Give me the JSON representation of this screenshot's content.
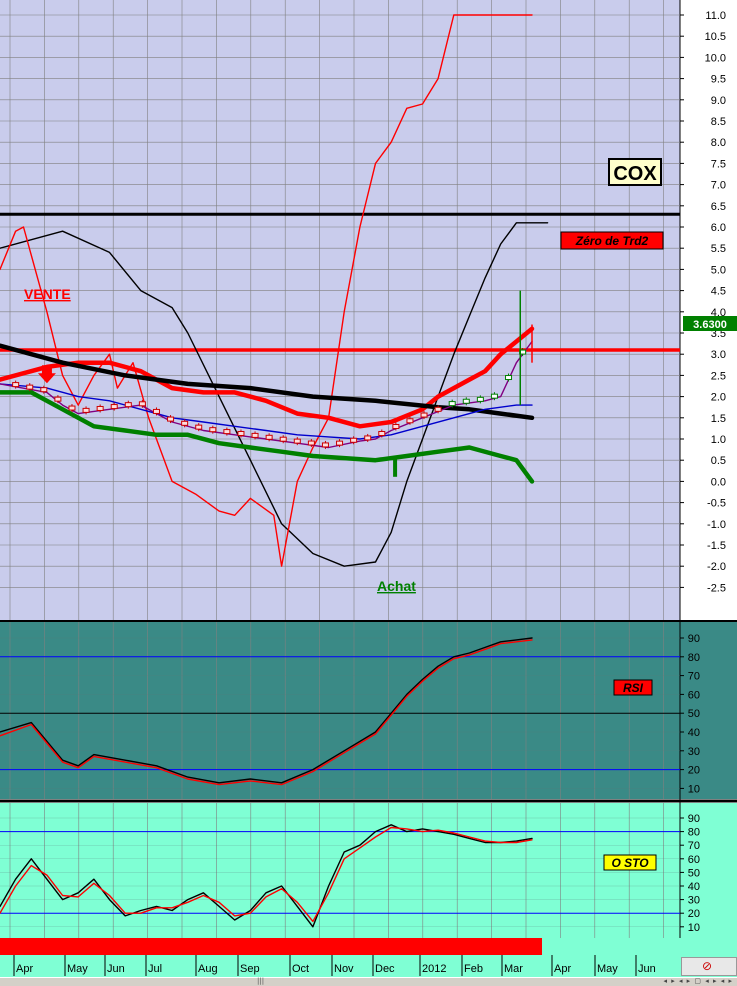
{
  "chart_data": [
    {
      "type": "line",
      "panel": "price",
      "ticker": "COX",
      "last_price_label": "3.6300",
      "ylim": [
        -3.0,
        11.3
      ],
      "y_ticks": [
        "11.0",
        "10.5",
        "10.0",
        "9.5",
        "9.0",
        "8.5",
        "8.0",
        "7.5",
        "7.0",
        "6.5",
        "6.0",
        "5.5",
        "5.0",
        "4.5",
        "4.0",
        "3.5",
        "3.0",
        "2.5",
        "2.0",
        "1.5",
        "1.0",
        "0.5",
        "0.0",
        "-0.5",
        "-1.0",
        "-1.5",
        "-2.0",
        "-2.5"
      ],
      "labels": {
        "sell": "VENTE",
        "buy": "Achat",
        "zero_line": "Zéro de Trd2"
      },
      "horizontal_lines": [
        {
          "y": 6.3,
          "color": "#000000"
        },
        {
          "y": 3.1,
          "color": "#ff0000"
        }
      ],
      "series": [
        {
          "color": "#000000",
          "x": [
            0,
            8,
            14,
            18,
            22,
            24,
            28,
            32,
            36,
            40,
            44,
            48,
            50,
            52,
            54,
            56,
            58,
            60,
            62,
            64,
            66,
            68,
            70
          ],
          "y": [
            5.5,
            5.9,
            5.4,
            4.5,
            4.1,
            3.5,
            2.0,
            0.5,
            -1.0,
            -1.7,
            -2.0,
            -1.9,
            -1.2,
            0.0,
            1.0,
            2.0,
            3.0,
            3.9,
            4.8,
            5.6,
            6.1,
            6.1,
            6.1
          ]
        },
        {
          "color": "#ff0000",
          "x": [
            0,
            2,
            3,
            6,
            8,
            10,
            12,
            14,
            15,
            17,
            19,
            22,
            25,
            28,
            30,
            32,
            35,
            36,
            38,
            40,
            42,
            44,
            46,
            48,
            50,
            52,
            54,
            56,
            58,
            60,
            62,
            64,
            66,
            68
          ],
          "y": [
            5.0,
            5.9,
            6.0,
            4.0,
            2.5,
            1.8,
            2.5,
            3.0,
            2.2,
            2.8,
            1.5,
            0.0,
            -0.3,
            -0.7,
            -0.8,
            -0.4,
            -0.8,
            -2.0,
            0.0,
            0.8,
            1.5,
            4.0,
            6.0,
            7.5,
            8.0,
            8.8,
            8.9,
            9.5,
            11.0,
            11.0,
            11.0,
            11.0,
            11.0,
            11.0
          ]
        },
        {
          "color": "#ff0000",
          "bold": true,
          "x": [
            0,
            6,
            10,
            14,
            18,
            22,
            26,
            30,
            34,
            38,
            42,
            46,
            50,
            54,
            56,
            58,
            60,
            62,
            64,
            66,
            68
          ],
          "y": [
            2.4,
            2.7,
            2.8,
            2.8,
            2.6,
            2.2,
            2.1,
            2.1,
            1.9,
            1.6,
            1.5,
            1.3,
            1.4,
            1.7,
            2.0,
            2.2,
            2.4,
            2.6,
            3.0,
            3.3,
            3.6
          ]
        },
        {
          "color": "#000000",
          "bold": true,
          "x": [
            0,
            8,
            16,
            24,
            32,
            40,
            48,
            56,
            60,
            64,
            68
          ],
          "y": [
            3.2,
            2.8,
            2.5,
            2.3,
            2.2,
            2.0,
            1.9,
            1.75,
            1.7,
            1.6,
            1.5
          ]
        },
        {
          "color": "#0000cc",
          "x": [
            0,
            6,
            10,
            14,
            18,
            22,
            26,
            30,
            34,
            38,
            42,
            46,
            50,
            54,
            58,
            62,
            66,
            68
          ],
          "y": [
            2.3,
            2.2,
            2.0,
            1.9,
            1.7,
            1.5,
            1.4,
            1.3,
            1.2,
            1.1,
            1.05,
            1.0,
            1.1,
            1.3,
            1.5,
            1.7,
            1.8,
            1.8
          ]
        },
        {
          "color": "#800080",
          "x": [
            0,
            6,
            8,
            10,
            14,
            18,
            22,
            26,
            30,
            34,
            38,
            42,
            46,
            48,
            50,
            54,
            58,
            62,
            64,
            66,
            68
          ],
          "y": [
            2.3,
            2.1,
            1.8,
            1.6,
            1.7,
            1.8,
            1.4,
            1.2,
            1.1,
            1.0,
            0.9,
            0.8,
            0.95,
            1.0,
            1.2,
            1.5,
            1.8,
            1.9,
            2.0,
            2.8,
            3.3
          ]
        },
        {
          "color": "#008000",
          "bold": true,
          "x": [
            0,
            4,
            8,
            12,
            16,
            20,
            24,
            28,
            32,
            36,
            40,
            44,
            48,
            52,
            56,
            60,
            64,
            66,
            68
          ],
          "y": [
            2.1,
            2.1,
            1.7,
            1.3,
            1.2,
            1.1,
            1.1,
            0.9,
            0.8,
            0.7,
            0.6,
            0.55,
            0.5,
            0.6,
            0.7,
            0.8,
            0.6,
            0.5,
            0.0
          ]
        }
      ]
    },
    {
      "type": "line",
      "panel": "rsi",
      "title": "RSI",
      "ylim": [
        0,
        98
      ],
      "y_ticks": [
        90,
        80,
        70,
        60,
        50,
        40,
        30,
        20,
        10
      ],
      "horizontal_lines": [
        {
          "y": 80,
          "color": "#0000ff"
        },
        {
          "y": 50,
          "color": "#000000"
        },
        {
          "y": 20,
          "color": "#0000ff"
        }
      ],
      "series": [
        {
          "color": "#000000",
          "x": [
            0,
            4,
            8,
            10,
            12,
            16,
            20,
            24,
            28,
            32,
            36,
            40,
            44,
            48,
            50,
            52,
            54,
            56,
            58,
            60,
            62,
            64,
            66,
            68
          ],
          "y": [
            40,
            45,
            25,
            22,
            28,
            25,
            22,
            16,
            13,
            15,
            13,
            20,
            30,
            40,
            50,
            60,
            68,
            75,
            80,
            82,
            85,
            88,
            89,
            90
          ]
        },
        {
          "color": "#ff0000",
          "x": [
            0,
            4,
            8,
            10,
            12,
            16,
            20,
            24,
            28,
            32,
            36,
            40,
            44,
            48,
            50,
            52,
            54,
            56,
            58,
            60,
            62,
            64,
            66,
            68
          ],
          "y": [
            38,
            44,
            24,
            21,
            27,
            24,
            21,
            15,
            12,
            14,
            12,
            19,
            29,
            39,
            49,
            59,
            67,
            74,
            79,
            81,
            84,
            87,
            88,
            89
          ]
        }
      ]
    },
    {
      "type": "line",
      "panel": "stochastic",
      "title": "O STO",
      "ylim": [
        0,
        98
      ],
      "y_ticks": [
        90,
        80,
        70,
        60,
        50,
        40,
        30,
        20,
        10
      ],
      "horizontal_lines": [
        {
          "y": 80,
          "color": "#0000ff"
        },
        {
          "y": 20,
          "color": "#0000ff"
        }
      ],
      "series": [
        {
          "color": "#000000",
          "x": [
            0,
            2,
            4,
            6,
            8,
            10,
            12,
            14,
            16,
            18,
            20,
            22,
            24,
            26,
            28,
            30,
            32,
            34,
            36,
            38,
            40,
            42,
            44,
            46,
            48,
            50,
            52,
            54,
            56,
            58,
            60,
            62,
            64,
            66,
            68
          ],
          "y": [
            25,
            45,
            60,
            45,
            30,
            35,
            45,
            30,
            18,
            22,
            25,
            22,
            30,
            35,
            25,
            15,
            22,
            35,
            40,
            25,
            10,
            40,
            65,
            70,
            80,
            85,
            80,
            82,
            80,
            78,
            75,
            72,
            72,
            73,
            75
          ]
        },
        {
          "color": "#ff0000",
          "x": [
            0,
            2,
            4,
            6,
            8,
            10,
            12,
            14,
            16,
            18,
            20,
            22,
            24,
            26,
            28,
            30,
            32,
            34,
            36,
            38,
            40,
            42,
            44,
            46,
            48,
            50,
            52,
            54,
            56,
            58,
            60,
            62,
            64,
            66,
            68
          ],
          "y": [
            20,
            40,
            55,
            48,
            33,
            32,
            42,
            33,
            20,
            20,
            24,
            24,
            28,
            33,
            28,
            18,
            20,
            32,
            38,
            28,
            14,
            35,
            60,
            68,
            76,
            83,
            82,
            80,
            81,
            79,
            76,
            73,
            72,
            72,
            74
          ]
        }
      ]
    },
    {
      "type": "table",
      "panel": "time_axis",
      "month_labels": [
        "Apr",
        "May",
        "Jun",
        "Jul",
        "Aug",
        "Sep",
        "Oct",
        "Nov",
        "Dec",
        "2012",
        "Feb",
        "Mar",
        "Apr",
        "May",
        "Jun"
      ]
    }
  ],
  "colors": {
    "price_bg": "#c9ccec",
    "rsi_bg": "#3a8a86",
    "sto_bg": "#7fffd4",
    "grid": "#808080",
    "signal_bar": "#ff0000"
  }
}
